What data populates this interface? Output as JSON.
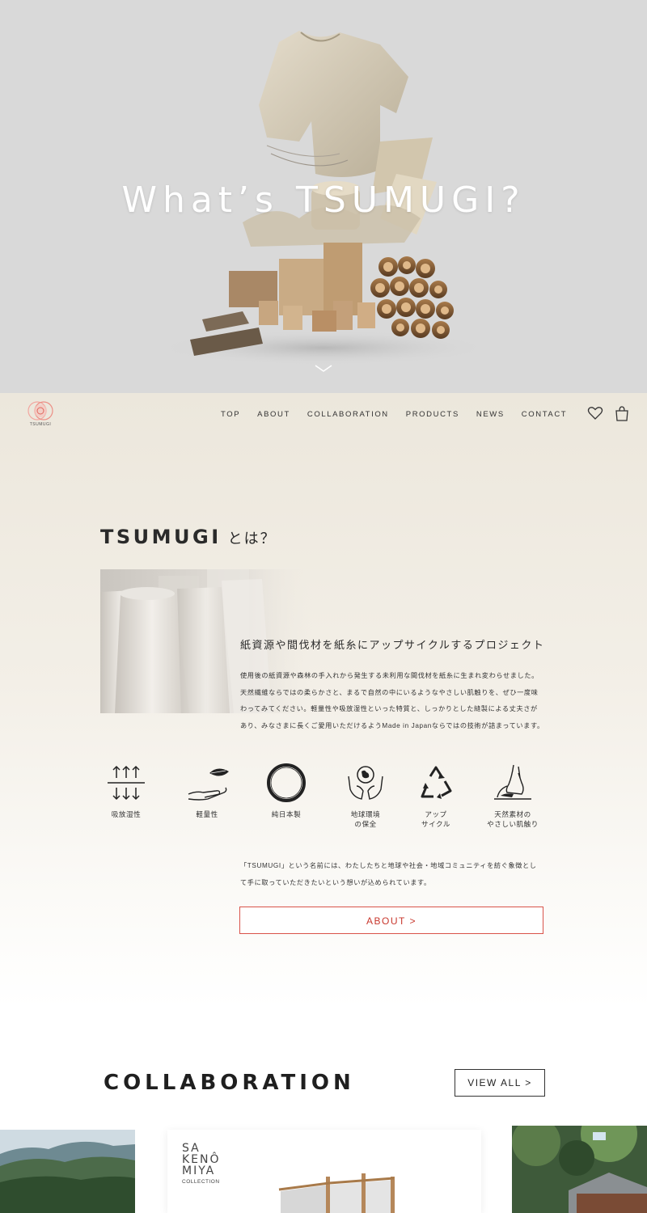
{
  "hero": {
    "title": "What’s TSUMUGI?"
  },
  "nav": {
    "logo_text": "TSUMUGI",
    "items": [
      "TOP",
      "ABOUT",
      "COLLABORATION",
      "PRODUCTS",
      "NEWS",
      "CONTACT"
    ]
  },
  "about": {
    "heading_en": "TSUMUGI",
    "heading_ja": "とは？",
    "subtitle": "紙資源や間伐材を紙糸にアップサイクルするプロジェクト",
    "body": [
      "使用後の紙資源や森林の手入れから発生する未利用な間伐材を紙糸に生まれ変わらせました。",
      "天然繊維ならではの柔らかさと、まるで自然の中にいるようなやさしい肌触りを、ぜひ一度味",
      "わってみてください。軽量性や吸放湿性といった特質と、しっかりとした縫製による丈夫さが",
      "あり、みなさまに長くご愛用いただけるようMade in Japanならではの技術が詰まっています。"
    ],
    "features": [
      {
        "icon": "moisture-arrows-icon",
        "label": "吸放湿性"
      },
      {
        "icon": "leaf-hand-icon",
        "label": "軽量性"
      },
      {
        "icon": "ensō-circle-icon",
        "label": "純日本製"
      },
      {
        "icon": "earth-hands-icon",
        "label": "地球環境\nの保全"
      },
      {
        "icon": "recycle-icon",
        "label": "アップ\nサイクル"
      },
      {
        "icon": "hand-touch-icon",
        "label": "天然素材の\nやさしい肌触り"
      }
    ],
    "name_text": [
      "「TSUMUGI」という名前には、わたしたちと地球や社会・地域コミュニティを紡ぐ象徴とし",
      "て手に取っていただきたいという想いが込められています。"
    ],
    "button_label": "ABOUT >"
  },
  "collaboration": {
    "title": "COLLABORATION",
    "view_all_label": "VIEW ALL >",
    "sakenomiya_lines": [
      "SA",
      "KENÔ",
      "MIYA"
    ],
    "sakenomiya_sub": "COLLECTION"
  },
  "colors": {
    "hero_bg": "#d9d9d9",
    "accent_red": "#c8372d",
    "section_bg": "#ece7dc",
    "text": "#2a2a2a"
  }
}
